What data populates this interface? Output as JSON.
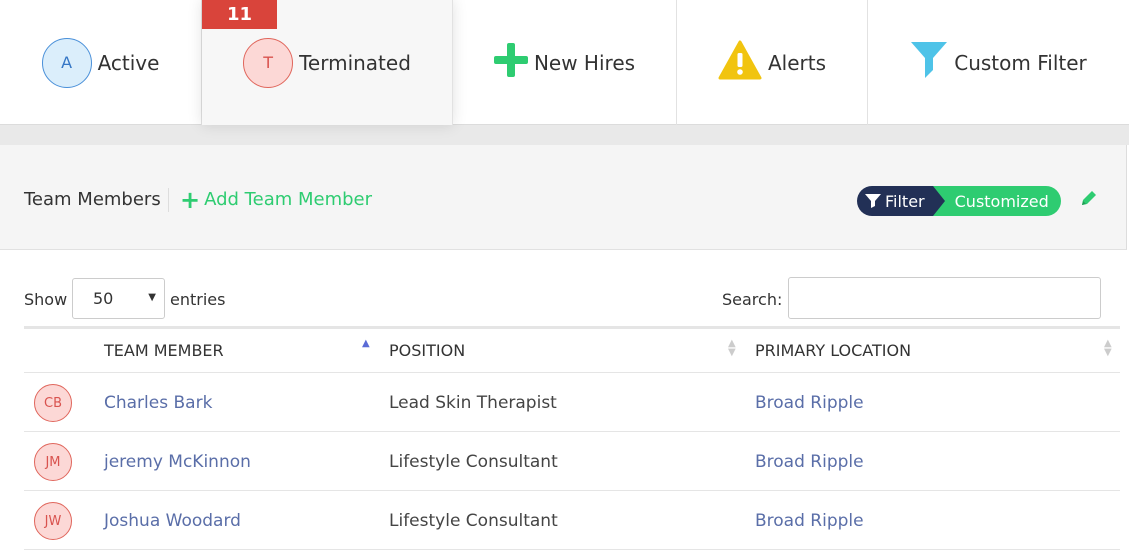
{
  "tabs": [
    {
      "label": "Active",
      "avatar_letter": "A"
    },
    {
      "label": "Terminated",
      "avatar_letter": "T",
      "badge": "11"
    },
    {
      "label": "New Hires",
      "icon": "plus-icon"
    },
    {
      "label": "Alerts",
      "icon": "warning-icon"
    },
    {
      "label": "Custom Filter",
      "icon": "funnel-icon"
    }
  ],
  "panel": {
    "title": "Team Members",
    "add_label": "Add Team Member",
    "filter_label": "Filter",
    "filter_state": "Customized"
  },
  "controls": {
    "show_label": "Show",
    "entries_value": "50",
    "entries_label": "entries",
    "search_label": "Search:",
    "search_value": ""
  },
  "table": {
    "columns": [
      "TEAM MEMBER",
      "POSITION",
      "PRIMARY LOCATION"
    ],
    "rows": [
      {
        "initials": "CB",
        "name": "Charles Bark",
        "position": "Lead Skin Therapist",
        "location": "Broad Ripple"
      },
      {
        "initials": "JM",
        "name": "jeremy McKinnon",
        "position": "Lifestyle Consultant",
        "location": "Broad Ripple"
      },
      {
        "initials": "JW",
        "name": "Joshua Woodard",
        "position": "Lifestyle Consultant",
        "location": "Broad Ripple"
      }
    ]
  },
  "colors": {
    "accent_green": "#2ecc71",
    "navy": "#223056",
    "badge_red": "#d9443b",
    "link_blue": "#5a6ea8",
    "alert_yellow": "#f1c40f",
    "filter_cyan": "#4ec3e8"
  }
}
